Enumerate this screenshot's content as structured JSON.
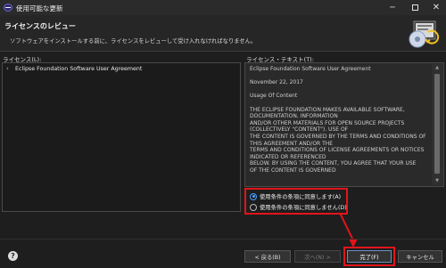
{
  "window": {
    "title": "使用可能な更新",
    "icon": "eclipse-app-icon",
    "controls": {
      "minimize": "─",
      "close": "✕"
    }
  },
  "header": {
    "title": "ライセンスのレビュー",
    "description": "ソフトウェアをインストールする前に、ライセンスをレビューして受け入れなければなりません。"
  },
  "licenses": {
    "label": "ライセンス(L):",
    "items": [
      {
        "label": "Eclipse Foundation Software User Agreement"
      }
    ]
  },
  "license_text": {
    "label": "ライセンス・テキスト(T):",
    "lines": [
      "Eclipse Foundation Software User Agreement",
      "",
      "November 22, 2017",
      "",
      "Usage Of Content",
      "",
      "THE ECLIPSE FOUNDATION MAKES AVAILABLE SOFTWARE,",
      "DOCUMENTATION, INFORMATION",
      "AND/OR OTHER MATERIALS FOR OPEN SOURCE PROJECTS",
      "(COLLECTIVELY \"CONTENT\"). USE OF",
      "THE CONTENT IS GOVERNED BY THE TERMS AND CONDITIONS OF",
      "THIS AGREEMENT AND/OR THE",
      "TERMS AND CONDITIONS OF LICENSE AGREEMENTS OR NOTICES",
      "INDICATED OR REFERENCED",
      "BELOW. BY USING THE CONTENT, YOU AGREE THAT YOUR USE",
      "OF THE CONTENT IS GOVERNED"
    ]
  },
  "agreement": {
    "accept": {
      "label": "使用条件の条項に同意します(A)",
      "checked": true
    },
    "decline": {
      "label": "使用条件の条項に同意しません(D)",
      "checked": false
    }
  },
  "buttons": {
    "back": "< 戻る(B)",
    "next": "次へ(N) >",
    "finish": "完了(F)",
    "cancel": "キャンセル"
  },
  "colors": {
    "highlight": "#e3141b",
    "radio_accent": "#4aa3ff",
    "background": "#1e1e1e"
  }
}
